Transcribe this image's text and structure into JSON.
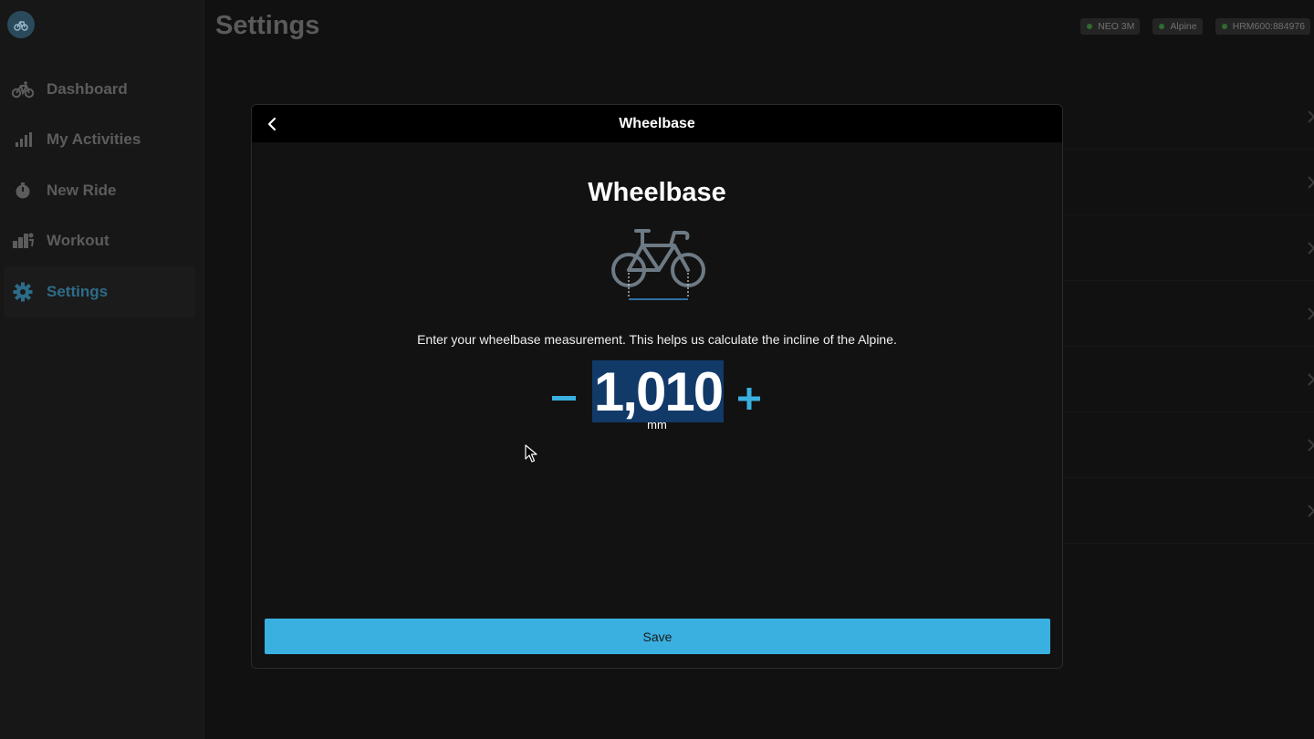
{
  "header": {
    "title": "Settings",
    "devices": [
      {
        "label": "NEO 3M"
      },
      {
        "label": "Alpine"
      },
      {
        "label": "HRM600:884976"
      }
    ]
  },
  "sidebar": {
    "logo_icon": "bike-logo-icon",
    "items": [
      {
        "label": "Dashboard",
        "icon": "bike-icon",
        "active": false
      },
      {
        "label": "My Activities",
        "icon": "bar-chart-icon",
        "active": false
      },
      {
        "label": "New Ride",
        "icon": "stopwatch-icon",
        "active": false
      },
      {
        "label": "Workout",
        "icon": "workout-icon",
        "active": false
      },
      {
        "label": "Settings",
        "icon": "gear-icon",
        "active": true
      }
    ]
  },
  "modal": {
    "header_title": "Wheelbase",
    "title": "Wheelbase",
    "description": "Enter your wheelbase measurement. This helps us calculate the incline of the Alpine.",
    "value": "1,010",
    "unit": "mm",
    "save_label": "Save"
  },
  "colors": {
    "accent": "#3ab0e0",
    "active_nav": "#2d6c89",
    "selection": "#113a69",
    "status_dot": "#2f6a2f"
  }
}
